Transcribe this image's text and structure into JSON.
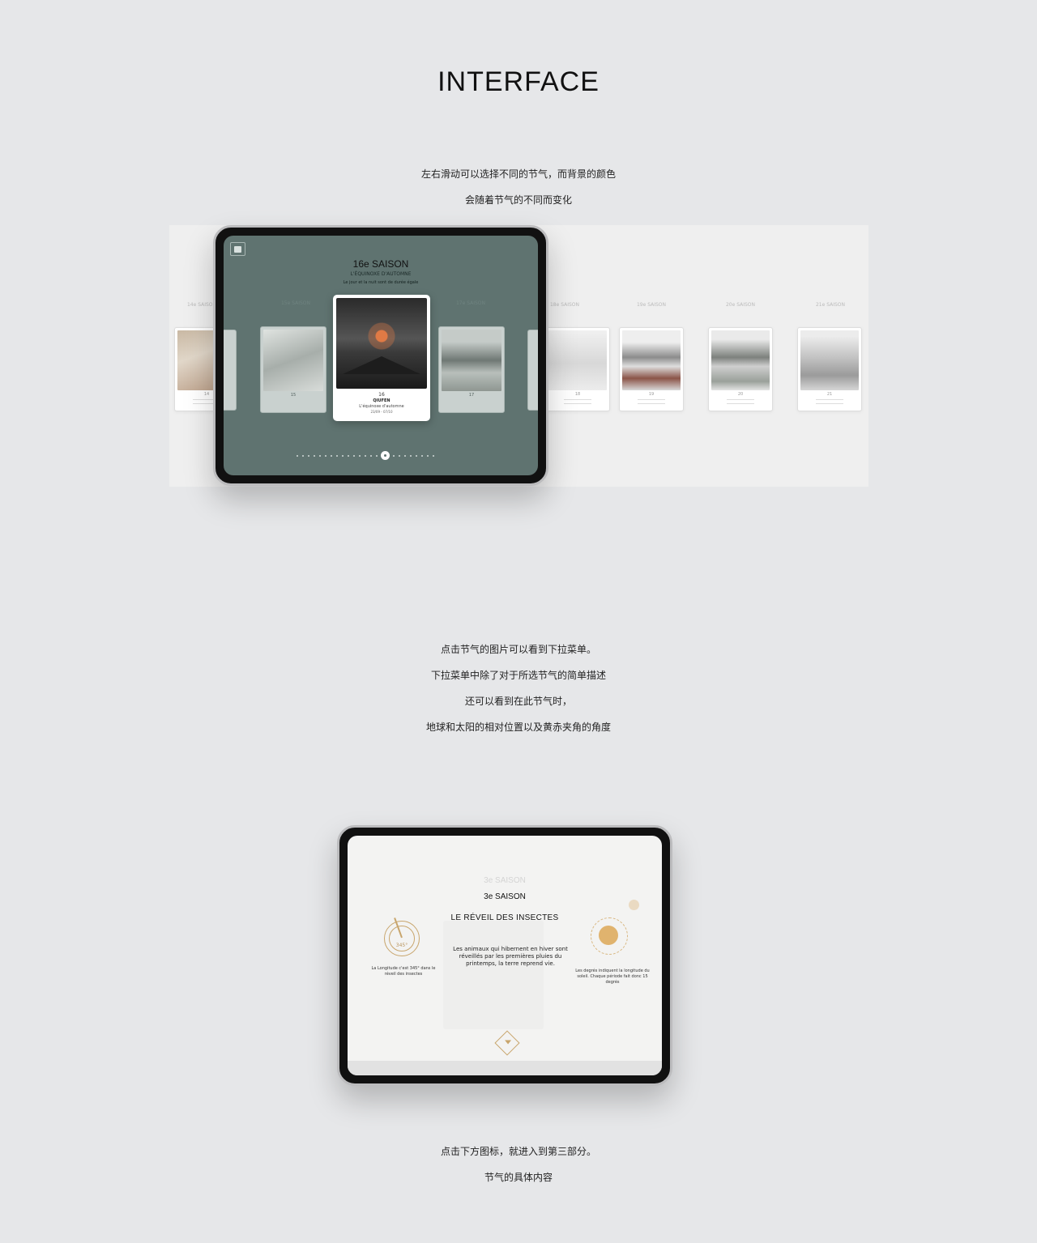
{
  "heading": "INTERFACE",
  "intro_lines": [
    "左右滑动可以选择不同的节气，而背景的颜色",
    "会随着节气的不同而变化"
  ],
  "carousel_screen": {
    "title": "16e SAISON",
    "subtitle": "L'ÉQUINOXE D'AUTOMNE",
    "description": "Le jour et la nuit sont de durée égale",
    "selected_card": {
      "number": "16",
      "name": "QIUFEN",
      "french": "L'équinoxe d'automne",
      "date": "23/09 - 07/10"
    },
    "side_cards": [
      {
        "label": "15e SAISON",
        "number": "15"
      },
      {
        "label": "17e SAISON",
        "number": "17"
      }
    ],
    "background_cards": [
      {
        "label": "14e SAISON",
        "number": "14"
      },
      {
        "label": "18e SAISON",
        "number": "18"
      },
      {
        "label": "19e SAISON",
        "number": "19"
      },
      {
        "label": "20e SAISON",
        "number": "20"
      },
      {
        "label": "21e SAISON",
        "number": "21"
      }
    ],
    "dot_count": 24,
    "active_dot": 16,
    "bg_color": "#5f7370"
  },
  "detail_caption_lines": [
    "点击节气的图片可以看到下拉菜单。",
    "下拉菜单中除了对于所选节气的简单描述",
    "还可以看到在此节气时，",
    "地球和太阳的相对位置以及黄赤夹角的角度"
  ],
  "detail_screen": {
    "ghost_title": "3e SAISON",
    "title": "3e SAISON",
    "name": "LE RÉVEIL DES INSECTES",
    "description": "Les animaux qui hibernent en hiver sont réveillés par les premières pluies du printemps, la terre reprend vie.",
    "angle": "345°",
    "longitude_text": "La Longitude c'est 345° dans le réveil des insectes",
    "sun_text": "Les degrés indiquent la longitude du soleil. Chaque période fait donc 15 degrés",
    "accent": "#c8a56c"
  },
  "final_caption_lines": [
    "点击下方图标，就进入到第三部分。",
    "节气的具体内容"
  ]
}
